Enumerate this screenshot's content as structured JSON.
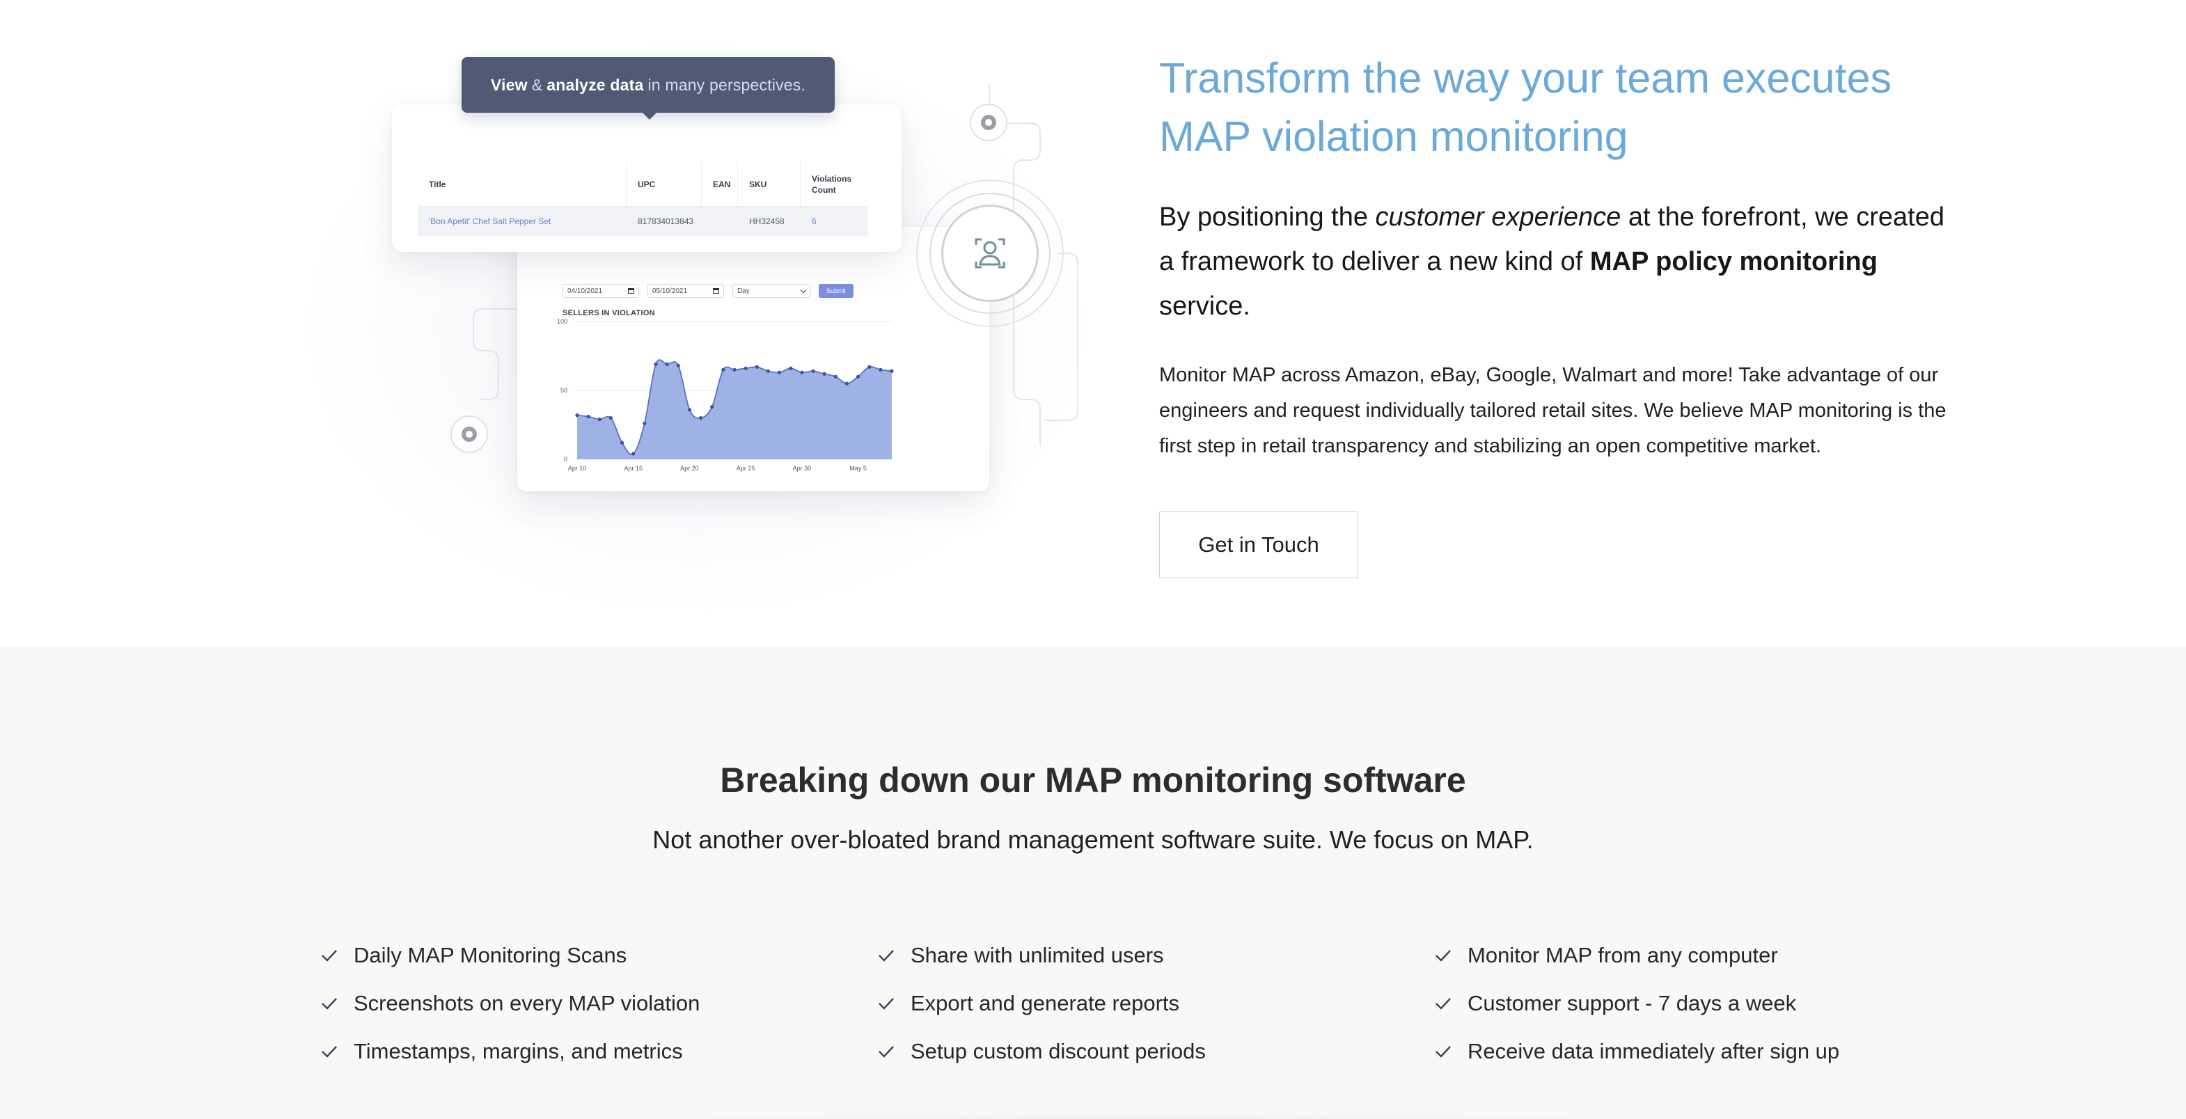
{
  "illustration": {
    "tooltip": {
      "part1": "View",
      "amp": "&",
      "part2": "analyze data",
      "part3": "in many perspectives."
    },
    "table": {
      "headers": [
        "Title",
        "UPC",
        "EAN",
        "SKU",
        "Violations Count"
      ],
      "row": {
        "title": "'Bon Apetit' Chef Salt Pepper Set",
        "upc": "817834013843",
        "ean": "",
        "sku": "HH32458",
        "violations": "6"
      }
    },
    "chart_controls": {
      "start_date": "04/10/2021",
      "end_date": "05/10/2021",
      "interval": "Day",
      "submit_label": "Submit"
    }
  },
  "chart_data": {
    "type": "area",
    "title": "SELLERS IN VIOLATION",
    "xlabel": "",
    "ylabel": "",
    "ylim": [
      0,
      100
    ],
    "yticks": [
      0,
      50,
      100
    ],
    "xtick_labels": [
      "Apr 10",
      "Apr 15",
      "Apr 20",
      "Apr 25",
      "Apr 30",
      "May 5"
    ],
    "x_index_of_ticks": [
      0,
      5,
      10,
      15,
      20,
      25
    ],
    "series": [
      {
        "values": [
          32,
          31,
          29,
          30,
          12,
          4,
          26,
          69,
          69,
          68,
          36,
          30,
          38,
          65,
          65,
          66,
          67,
          64,
          63,
          66,
          63,
          64,
          62,
          60,
          55,
          60,
          67,
          65,
          64
        ],
        "color": "#9aaee4"
      }
    ],
    "grid": true
  },
  "hero": {
    "headline": "Transform the way your team executes MAP violation monitoring",
    "lead": {
      "p1": "By positioning the ",
      "em": "customer experience",
      "p2": " at the forefront, we created a framework to deliver a new kind of ",
      "strong": "MAP policy monitoring",
      "p3": " service."
    },
    "body": "Monitor MAP across Amazon, eBay, Google, Walmart and more! Take advantage of our engineers and request individually tailored retail sites. We believe MAP monitoring is the first step in retail transparency and stabilizing an open competitive market.",
    "cta_label": "Get in Touch",
    "accent_color": "#6aa9d8"
  },
  "features": {
    "title": "Breaking down our MAP monitoring software",
    "subtitle": "Not another over-bloated brand management software suite. We focus on MAP.",
    "columns": [
      [
        "Daily MAP Monitoring Scans",
        "Screenshots on every MAP violation",
        "Timestamps, margins, and metrics"
      ],
      [
        "Share with unlimited users",
        "Export and generate reports",
        "Setup custom discount periods"
      ],
      [
        "Monitor MAP from any computer",
        "Customer support - 7 days a week",
        "Receive data immediately after sign up"
      ]
    ]
  }
}
